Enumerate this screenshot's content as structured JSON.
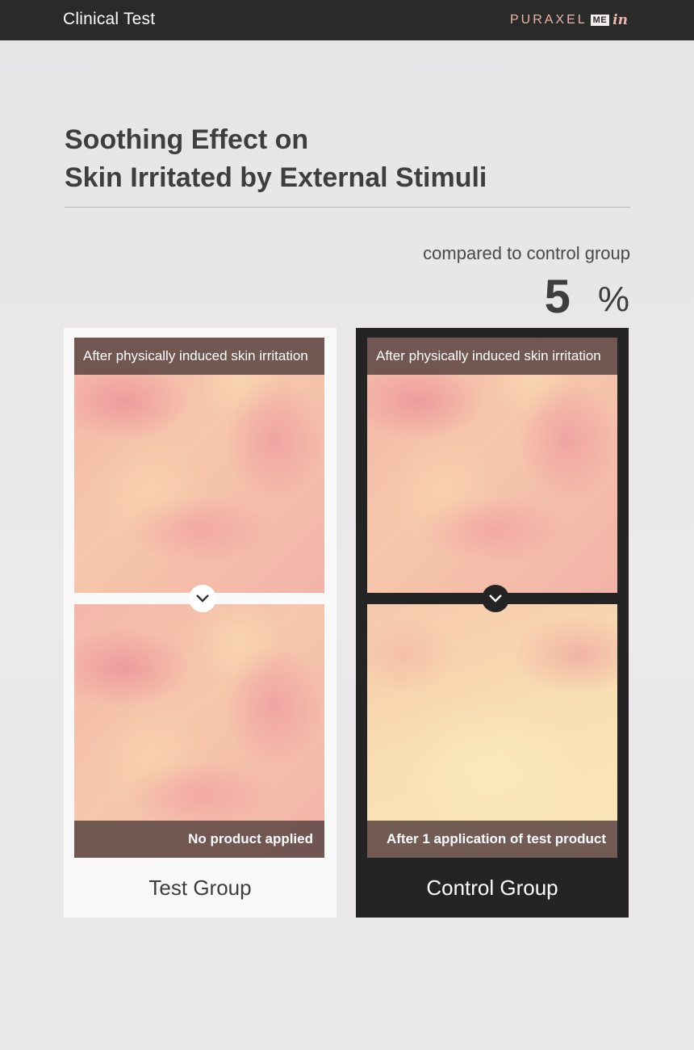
{
  "header": {
    "title": "Clinical Test",
    "brand": {
      "word": "PURAXEL",
      "box": "ME",
      "script": "in"
    }
  },
  "headline": {
    "line1": "Soothing Effect on",
    "line2": "Skin Irritated by External Stimuli"
  },
  "stat": {
    "caption": "compared to control group",
    "value": "5",
    "unit": "%"
  },
  "groups": [
    {
      "name": "Test Group",
      "top_label": "After physically induced skin irritation",
      "bottom_label": "No product applied"
    },
    {
      "name": "Control Group",
      "top_label": "After physically induced skin irritation",
      "bottom_label": "After 1 application of test product"
    }
  ],
  "icons": {
    "transition": "chevron-down-icon"
  },
  "colors": {
    "header_bg": "#2b2a2a",
    "brand_accent": "#e8b7a8",
    "dark_card": "#252424",
    "light_card": "#f9f9f9",
    "label_bar": "#5f4846"
  }
}
